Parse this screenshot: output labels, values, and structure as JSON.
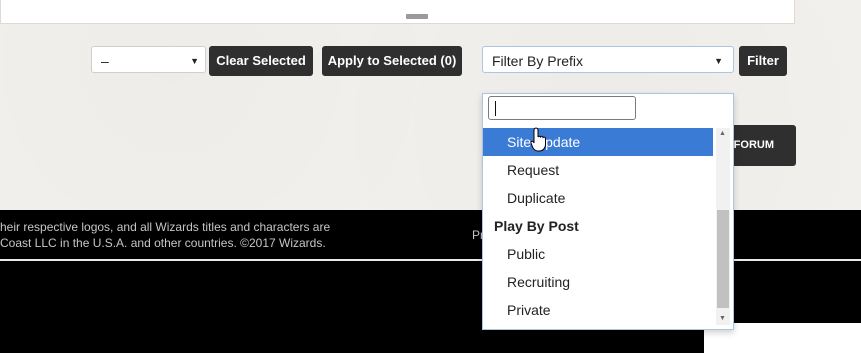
{
  "toolbar": {
    "action_select_value": "–",
    "clear_selected": "Clear Selected",
    "apply_to_selected": "Apply to Selected (0)",
    "prefix_select_value": "Filter By Prefix",
    "filter": "Filter"
  },
  "forum_button": "FORUM",
  "dropdown": {
    "search_value": "",
    "items": [
      {
        "type": "option",
        "label": "Site Update",
        "selected": true
      },
      {
        "type": "option",
        "label": "Request"
      },
      {
        "type": "option",
        "label": "Duplicate"
      },
      {
        "type": "group",
        "label": "Play By Post"
      },
      {
        "type": "option",
        "label": "Public"
      },
      {
        "type": "option",
        "label": "Recruiting"
      },
      {
        "type": "option",
        "label": "Private"
      }
    ]
  },
  "footer": {
    "legal_line1": "heir respective logos, and all Wizards titles and characters are",
    "legal_line2": "Coast LLC in the U.S.A. and other countries. ©2017 Wizards.",
    "partial_link": "Pr"
  },
  "colors": {
    "selected_option": "#3a7bd5",
    "button_bg": "#2f2f2f",
    "footer_bg": "#000000"
  }
}
